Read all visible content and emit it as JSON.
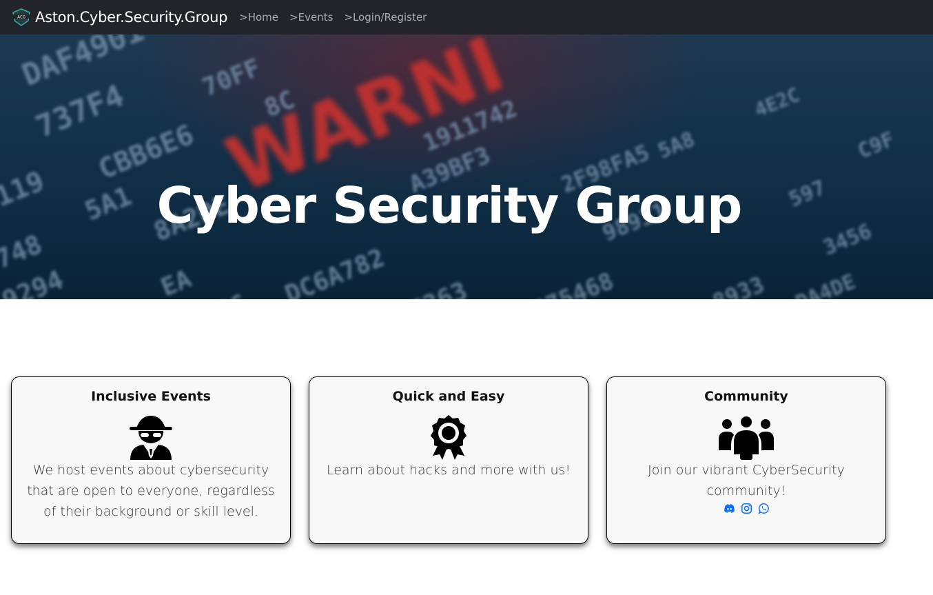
{
  "navbar": {
    "brand_text": "Aston.Cyber.Security.Group",
    "logo_icon": "acsg-shield-logo",
    "links": [
      ">Home",
      ">Events",
      ">Login/Register"
    ]
  },
  "hero": {
    "title": "Cyber Security Group",
    "background": "blurred hex code with red WARNING text"
  },
  "cards": [
    {
      "title": "Inclusive Events",
      "icon": "user-secret-icon",
      "text": "We host events about cybersecurity that are open to everyone, regardless of their background or skill level."
    },
    {
      "title": "Quick and Easy",
      "icon": "award-ribbon-icon",
      "text": "Learn about hacks and more with us!"
    },
    {
      "title": "Community",
      "icon": "people-group-icon",
      "text": "Join our vibrant CyberSecurity community!",
      "socials": [
        "discord-icon",
        "instagram-icon",
        "whatsapp-icon"
      ]
    }
  ],
  "colors": {
    "navbar_bg": "#212529",
    "nav_link": "#9a9da0",
    "social_link": "#0d6efd",
    "card_bg": "#f8f8f8"
  }
}
